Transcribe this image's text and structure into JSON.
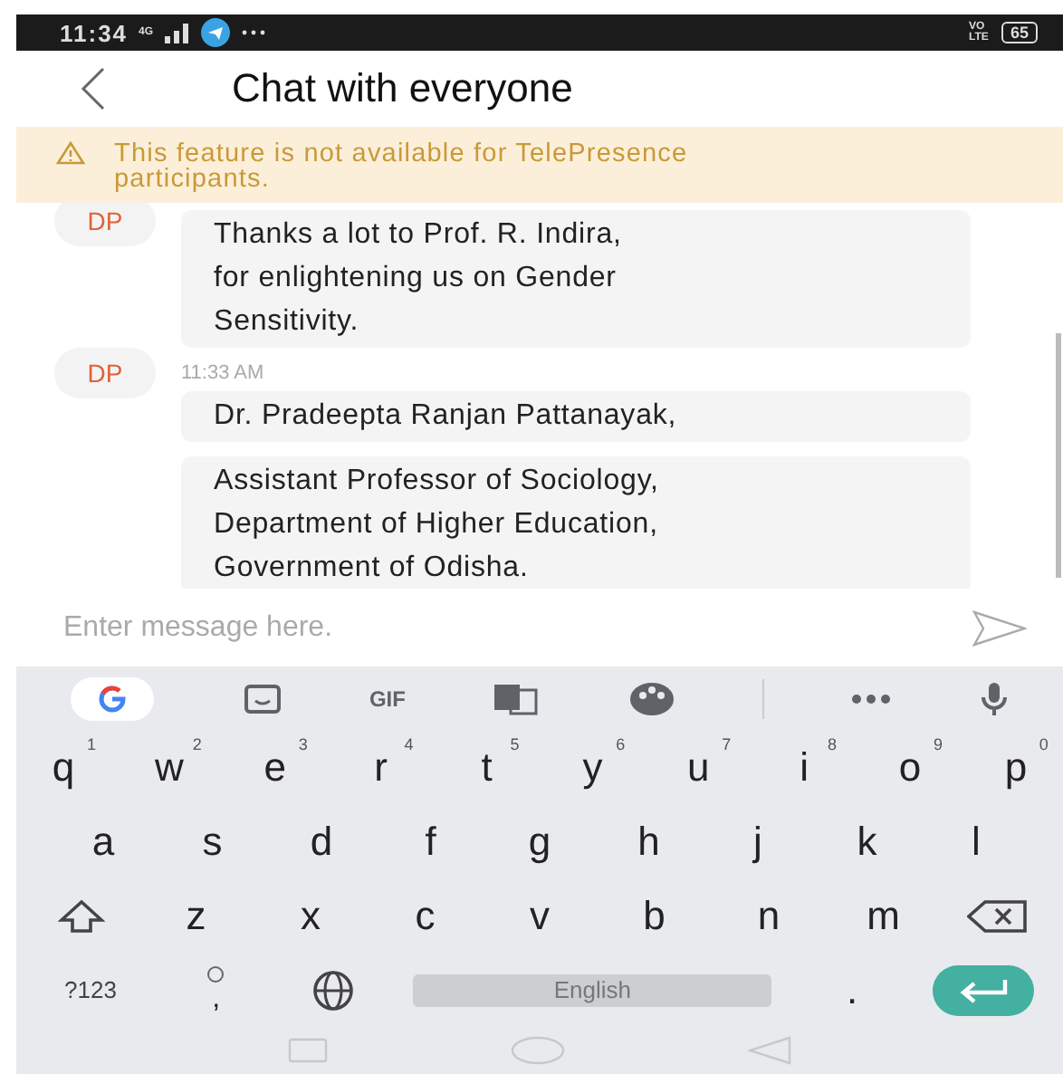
{
  "status_bar": {
    "time": "11:34",
    "network": "4G",
    "volte": "VO LTE",
    "battery": "65"
  },
  "header": {
    "title": "Chat with everyone"
  },
  "banner": {
    "text": "This feature is not available for TelePresence participants."
  },
  "messages": [
    {
      "avatar": "DP",
      "bubbles": [
        {
          "lines": [
            "Thanks a lot to Prof. R. Indira,",
            "for enlightening us on Gender",
            "Sensitivity."
          ]
        }
      ]
    },
    {
      "avatar": "DP",
      "time": "11:33 AM",
      "bubbles": [
        {
          "lines": [
            "Dr. Pradeepta Ranjan Pattanayak,"
          ]
        },
        {
          "lines": [
            "Assistant Professor of Sociology,",
            "Department of Higher Education,",
            "Government of Odisha."
          ]
        }
      ]
    }
  ],
  "composer": {
    "placeholder": "Enter message here."
  },
  "keyboard": {
    "toolbar": [
      {
        "kind": "google"
      },
      {
        "kind": "sticker"
      },
      {
        "kind": "gif",
        "label": "GIF"
      },
      {
        "kind": "translate"
      },
      {
        "kind": "palette"
      },
      {
        "kind": "divider"
      },
      {
        "kind": "more"
      },
      {
        "kind": "mic"
      }
    ],
    "rows": [
      [
        {
          "kind": "letter",
          "label": "q",
          "hint": "1"
        },
        {
          "kind": "letter",
          "label": "w",
          "hint": "2"
        },
        {
          "kind": "letter",
          "label": "e",
          "hint": "3"
        },
        {
          "kind": "letter",
          "label": "r",
          "hint": "4"
        },
        {
          "kind": "letter",
          "label": "t",
          "hint": "5"
        },
        {
          "kind": "letter",
          "label": "y",
          "hint": "6"
        },
        {
          "kind": "letter",
          "label": "u",
          "hint": "7"
        },
        {
          "kind": "letter",
          "label": "i",
          "hint": "8"
        },
        {
          "kind": "letter",
          "label": "o",
          "hint": "9"
        },
        {
          "kind": "letter",
          "label": "p",
          "hint": "0"
        }
      ],
      [
        {
          "kind": "letter",
          "label": "a"
        },
        {
          "kind": "letter",
          "label": "s"
        },
        {
          "kind": "letter",
          "label": "d"
        },
        {
          "kind": "letter",
          "label": "f"
        },
        {
          "kind": "letter",
          "label": "g"
        },
        {
          "kind": "letter",
          "label": "h"
        },
        {
          "kind": "letter",
          "label": "j"
        },
        {
          "kind": "letter",
          "label": "k"
        },
        {
          "kind": "letter",
          "label": "l"
        }
      ],
      [
        {
          "kind": "shift"
        },
        {
          "kind": "letter",
          "label": "z"
        },
        {
          "kind": "letter",
          "label": "x"
        },
        {
          "kind": "letter",
          "label": "c"
        },
        {
          "kind": "letter",
          "label": "v"
        },
        {
          "kind": "letter",
          "label": "b"
        },
        {
          "kind": "letter",
          "label": "n"
        },
        {
          "kind": "letter",
          "label": "m"
        },
        {
          "kind": "backspace"
        }
      ],
      [
        {
          "kind": "symbols",
          "label": "?123"
        },
        {
          "kind": "comma",
          "label": ","
        },
        {
          "kind": "globe"
        },
        {
          "kind": "space",
          "label": "English"
        },
        {
          "kind": "period",
          "label": "."
        },
        {
          "kind": "enter"
        }
      ]
    ]
  }
}
